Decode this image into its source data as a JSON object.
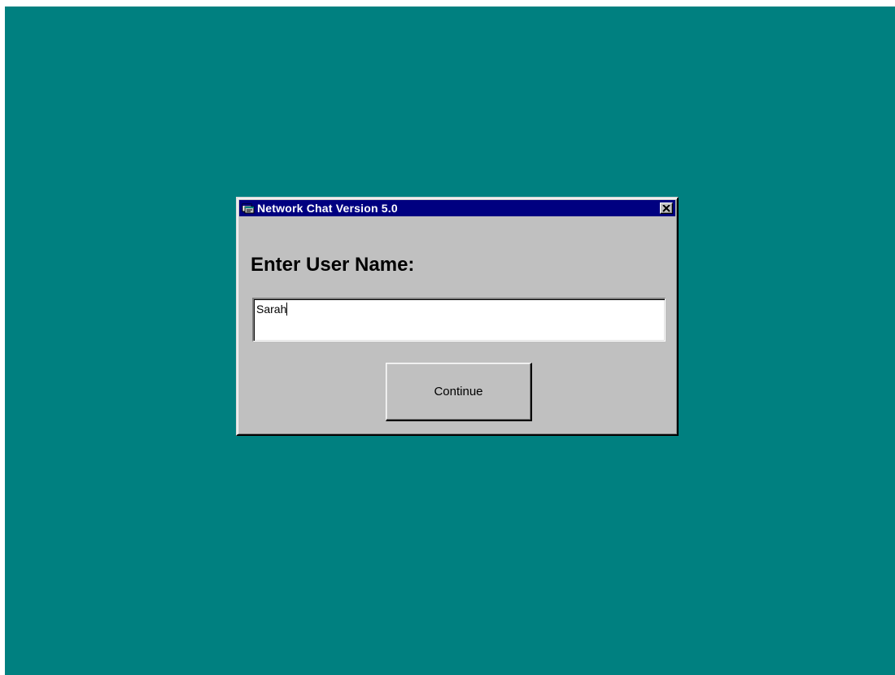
{
  "desktop": {
    "background_color": "#008080"
  },
  "window": {
    "title": "Network Chat Version 5.0",
    "app_icon": "chat-app-icon",
    "close_icon": "close-x-icon",
    "titlebar_color": "#000080",
    "face_color": "#c0c0c0"
  },
  "form": {
    "prompt": "Enter User Name:",
    "username_value": "Sarah",
    "continue_label": "Continue"
  }
}
